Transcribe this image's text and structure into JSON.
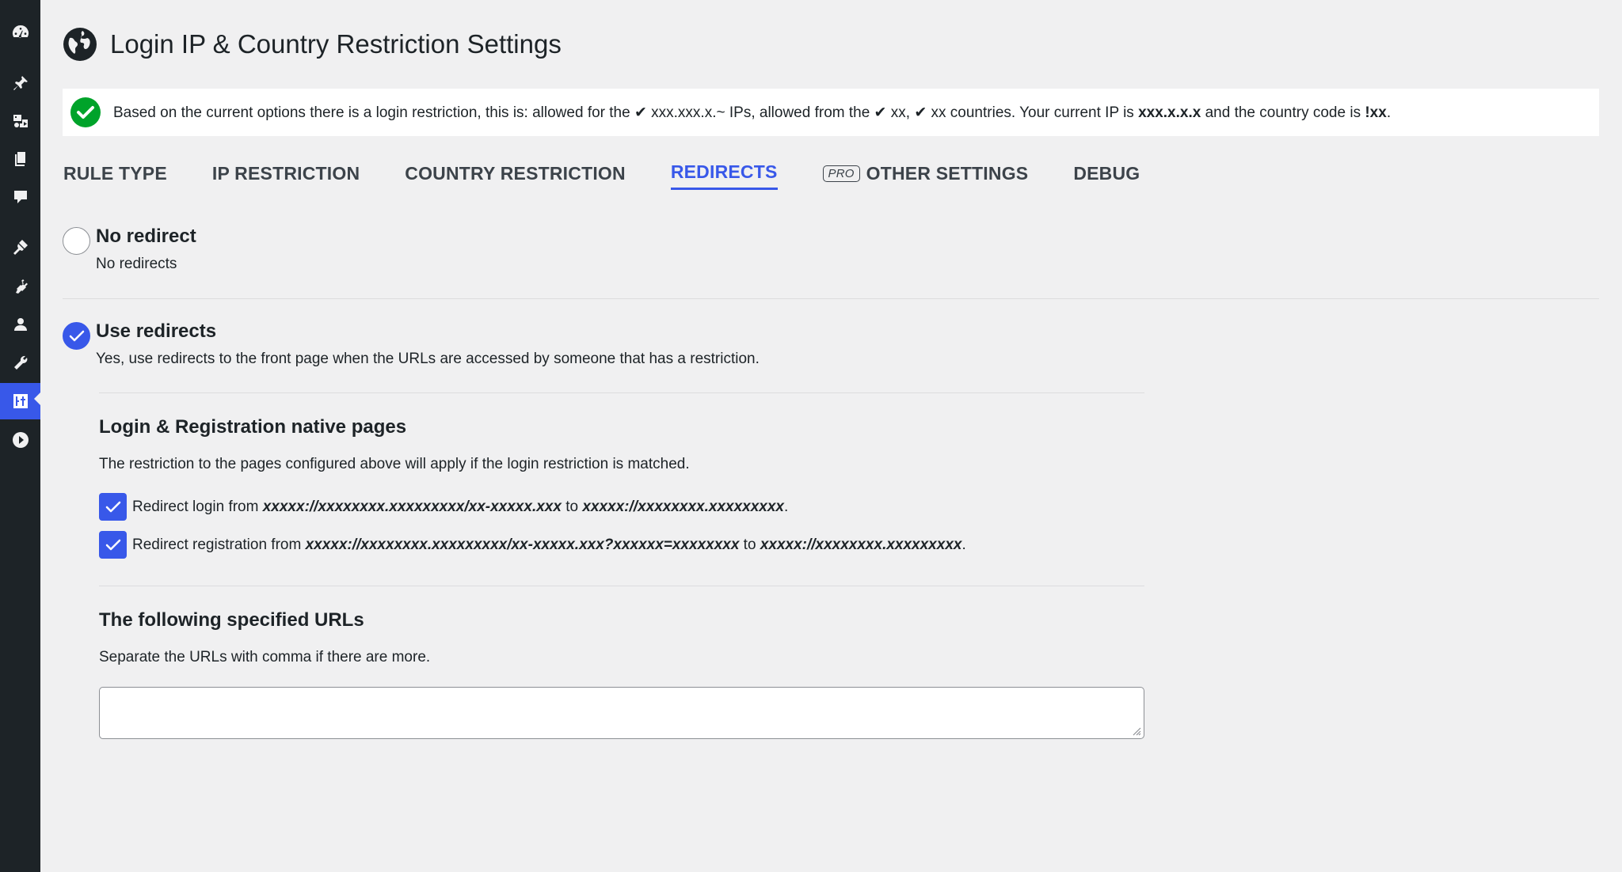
{
  "sidebar": {
    "items": [
      {
        "icon": "dashboard-icon"
      },
      {
        "icon": "pin-icon"
      },
      {
        "icon": "media-icon"
      },
      {
        "icon": "pages-icon"
      },
      {
        "icon": "comments-icon"
      },
      {
        "icon": "appearance-icon"
      },
      {
        "icon": "plugins-icon"
      },
      {
        "icon": "users-icon"
      },
      {
        "icon": "tools-icon"
      },
      {
        "icon": "settings-icon",
        "active": true
      },
      {
        "icon": "play-icon"
      }
    ]
  },
  "page": {
    "title": "Login IP & Country Restriction Settings"
  },
  "notice": {
    "part1": "Based on the current options there is a login restriction, this is: allowed for the ✔ xxx.xxx.x.~ IPs, allowed from the ✔ xx, ✔ xx countries. Your current IP is ",
    "ip": "xxx.x.x.x",
    "part2": " and the country code is ",
    "country": "!xx",
    "part3": "."
  },
  "tabs": [
    {
      "label": "Rule type"
    },
    {
      "label": "IP restriction"
    },
    {
      "label": "Country restriction"
    },
    {
      "label": "Redirects",
      "active": true
    },
    {
      "label": "Other settings",
      "badge": "PRO"
    },
    {
      "label": "Debug"
    }
  ],
  "options": {
    "no_redirect": {
      "title": "No redirect",
      "desc": "No redirects",
      "checked": false
    },
    "use_redirects": {
      "title": "Use redirects",
      "desc": "Yes, use redirects to the front page when the URLs are accessed by someone that has a restriction.",
      "checked": true
    }
  },
  "native": {
    "heading": "Login & Registration native pages",
    "desc": "The restriction to the pages configured above will apply if the login restriction is matched.",
    "login": {
      "prefix": "Redirect login from ",
      "from": "xxxxx://xxxxxxxx.xxxxxxxxx/xx-xxxxx.xxx",
      "to_word": " to ",
      "to": "xxxxx://xxxxxxxx.xxxxxxxxx",
      "end": ".",
      "checked": true
    },
    "registration": {
      "prefix": "Redirect registration from ",
      "from": "xxxxx://xxxxxxxx.xxxxxxxxx/xx-xxxxx.xxx?xxxxxx=xxxxxxxx",
      "to_word": " to ",
      "to": "xxxxx://xxxxxxxx.xxxxxxxxx",
      "end": ".",
      "checked": true
    }
  },
  "specified": {
    "heading": "The following specified URLs",
    "desc": "Separate the URLs with comma if there are more.",
    "value": ""
  },
  "colors": {
    "accent": "#3858e9",
    "success": "#00a32a",
    "sidebar": "#1d2327"
  }
}
